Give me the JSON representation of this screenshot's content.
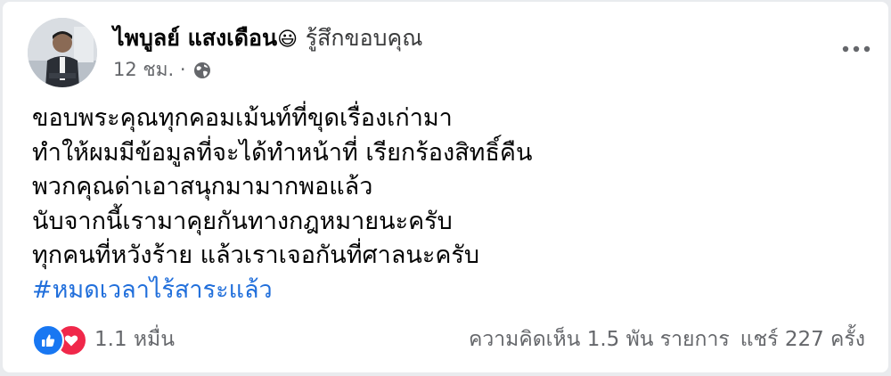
{
  "post": {
    "author": "ไพบูลย์ แสงเดือน",
    "feeling": "รู้สึกขอบคุณ",
    "time": "12 ชม. ·",
    "body_lines": [
      "ขอบพระคุณทุกคอมเม้นท์ที่ขุดเรื่องเก่ามา",
      "ทำให้ผมมีข้อมูลที่จะได้ทำหน้าที่ เรียกร้องสิทธิ์คืน",
      "พวกคุณด่าเอาสนุกมามากพอแล้ว",
      "นับจากนี้เรามาคุยกันทางกฎหมายนะครับ",
      "ทุกคนที่หวังร้าย แล้วเราเจอกันที่ศาลนะครับ"
    ],
    "hashtag": "#หมดเวลาไร้สาระแล้ว"
  },
  "footer": {
    "reactions_count": "1.1 หมื่น",
    "comments": "ความคิดเห็น 1.5 พัน รายการ",
    "shares": "แชร์ 227 ครั้ง"
  },
  "icons": {
    "feeling": "smiling-face-emoji",
    "privacy": "globe-icon",
    "menu": "more-options-icon",
    "reactions": [
      "like-icon",
      "love-icon"
    ]
  },
  "colors": {
    "like_blue": "#1877f2",
    "love_red": "#f0284a",
    "hashtag_link": "#216fdb",
    "secondary_text": "#65676b"
  }
}
